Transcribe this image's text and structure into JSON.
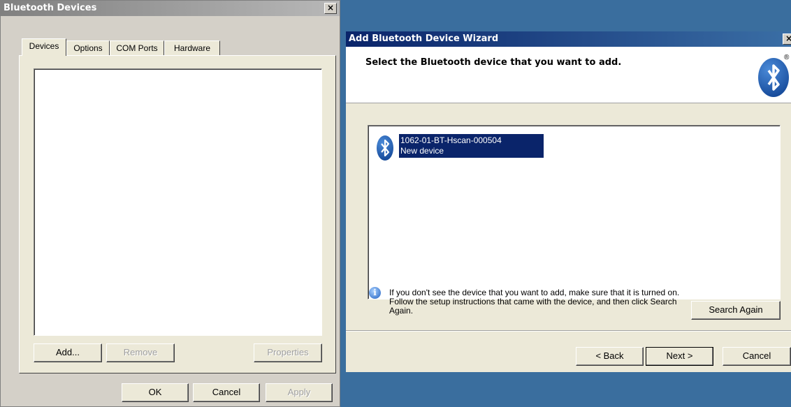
{
  "bt_devices": {
    "title": "Bluetooth Devices",
    "close": "×",
    "tabs": [
      "Devices",
      "Options",
      "COM Ports",
      "Hardware"
    ],
    "add_label": "Add...",
    "remove_label": "Remove",
    "properties_label": "Properties",
    "ok_label": "OK",
    "cancel_label": "Cancel",
    "apply_label": "Apply"
  },
  "wizard": {
    "title": "Add Bluetooth Device Wizard",
    "close": "×",
    "heading": "Select the Bluetooth device that you want to add.",
    "logo_mark": "®",
    "device": {
      "name": "1062-01-BT-Hscan-000504",
      "status": "New device"
    },
    "info_text": "If you don't see the device that you want to add, make sure that it is turned on. Follow the setup instructions that came with the device, and then click Search Again.",
    "search_again_label": "Search Again",
    "back_label": "< Back",
    "next_label": "Next >",
    "cancel_label": "Cancel"
  },
  "colors": {
    "title_active": "#0a246a",
    "title_inactive": "#7a96df",
    "selection": "#0a246a",
    "face": "#ece9d8"
  }
}
